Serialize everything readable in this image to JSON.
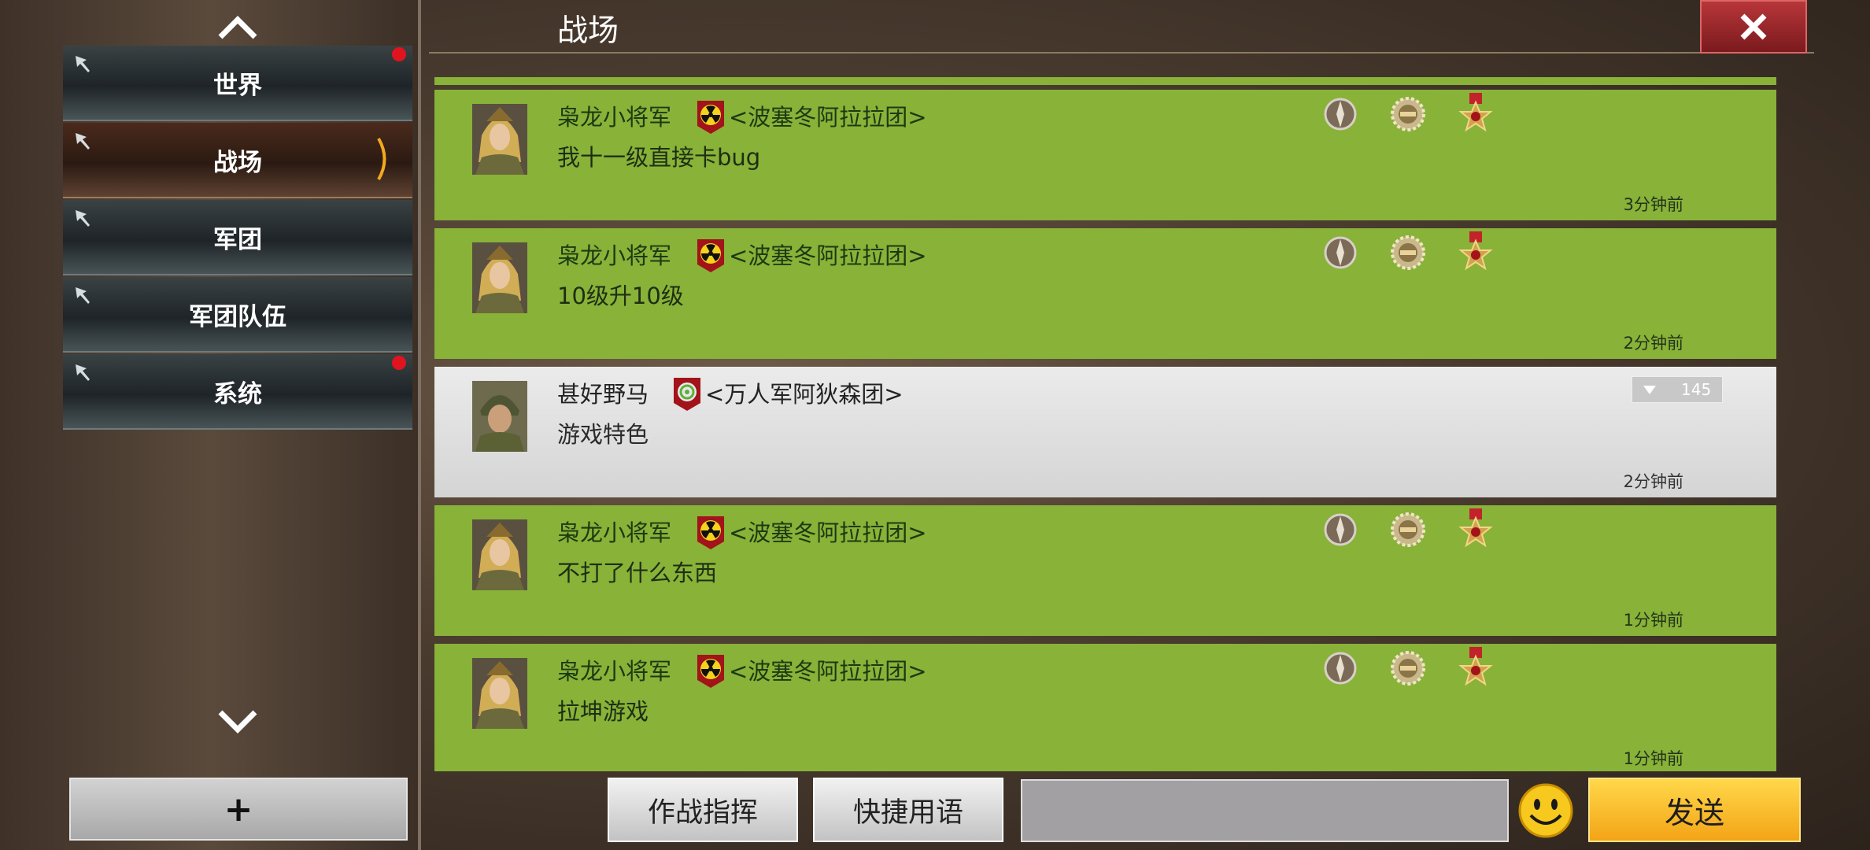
{
  "page": {
    "title": "战场"
  },
  "sidebar": {
    "items": [
      {
        "label": "世界",
        "has_alert": true,
        "active": false
      },
      {
        "label": "战场",
        "has_alert": false,
        "active": true
      },
      {
        "label": "军团",
        "has_alert": false,
        "active": false
      },
      {
        "label": "军团队伍",
        "has_alert": false,
        "active": false
      },
      {
        "label": "系统",
        "has_alert": true,
        "active": false
      }
    ],
    "add_label": "+"
  },
  "messages": [
    {
      "sender": "枭龙小将军",
      "guild": "<波塞冬阿拉拉团>",
      "text": "我十一级直接卡bug",
      "time": "3分钟前",
      "style": "green",
      "medals": 3
    },
    {
      "sender": "枭龙小将军",
      "guild": "<波塞冬阿拉拉团>",
      "text": "10级升10级",
      "time": "2分钟前",
      "style": "green",
      "medals": 3
    },
    {
      "sender": "甚好野马",
      "guild": "<万人军阿狄森团>",
      "text": "游戏特色",
      "time": "2分钟前",
      "style": "grey",
      "rank": "145"
    },
    {
      "sender": "枭龙小将军",
      "guild": "<波塞冬阿拉拉团>",
      "text": "不打了什么东西",
      "time": "1分钟前",
      "style": "green",
      "medals": 3
    },
    {
      "sender": "枭龙小将军",
      "guild": "<波塞冬阿拉拉团>",
      "text": "拉坤游戏",
      "time": "1分钟前",
      "style": "green",
      "medals": 3
    }
  ],
  "bottom": {
    "combat_command_label": "作战指挥",
    "quick_phrases_label": "快捷用语",
    "input_value": "",
    "send_label": "发送"
  },
  "icons": {
    "close": "close-icon",
    "scroll_up": "chevron-up-icon",
    "scroll_down": "chevron-down-icon",
    "pin": "pin-icon",
    "emoji": "smiley-icon",
    "radiation_badge": "radiation-badge-icon",
    "target_badge": "target-badge-icon"
  },
  "colors": {
    "message_green": "#88b238",
    "message_grey": "#e0e0e0",
    "alert_red": "#e0141e",
    "send_yellow": "#f3a416",
    "close_red": "#b8363a"
  }
}
